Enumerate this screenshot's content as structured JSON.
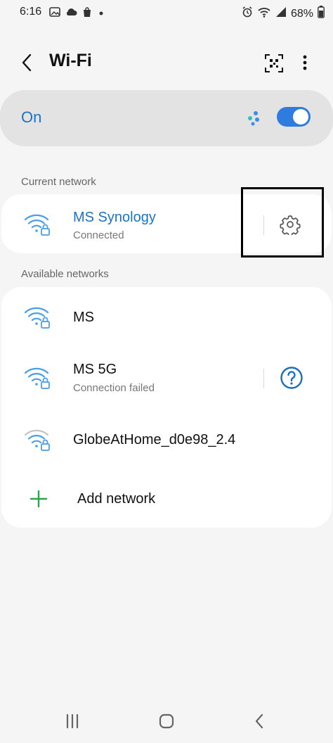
{
  "status": {
    "time": "6:16",
    "battery": "68%"
  },
  "header": {
    "title": "Wi-Fi"
  },
  "master_toggle": {
    "label": "On",
    "state": "on"
  },
  "current_section": {
    "label": "Current network",
    "network": {
      "name": "MS Synology",
      "status": "Connected"
    }
  },
  "available_section": {
    "label": "Available networks",
    "networks": [
      {
        "name": "MS",
        "status": ""
      },
      {
        "name": "MS 5G",
        "status": "Connection failed"
      },
      {
        "name": "GlobeAtHome_d0e98_2.4",
        "status": ""
      }
    ],
    "add_label": "Add network"
  },
  "colors": {
    "accent": "#1a73c7",
    "wifi": "#4a9fe8",
    "add_green": "#2ea44f"
  },
  "icons": {
    "status": [
      "photo-icon",
      "cloud-icon",
      "shop-icon",
      "dot-icon",
      "alarm-icon",
      "wifi-status-icon",
      "signal-icon",
      "battery-icon"
    ],
    "header": [
      "back-icon",
      "qr-code-icon",
      "more-options-icon"
    ],
    "networks": [
      "wifi-lock-icon",
      "settings-gear-icon",
      "help-circle-icon",
      "add-icon"
    ],
    "nav": [
      "recent-apps-icon",
      "home-icon",
      "nav-back-icon"
    ]
  }
}
